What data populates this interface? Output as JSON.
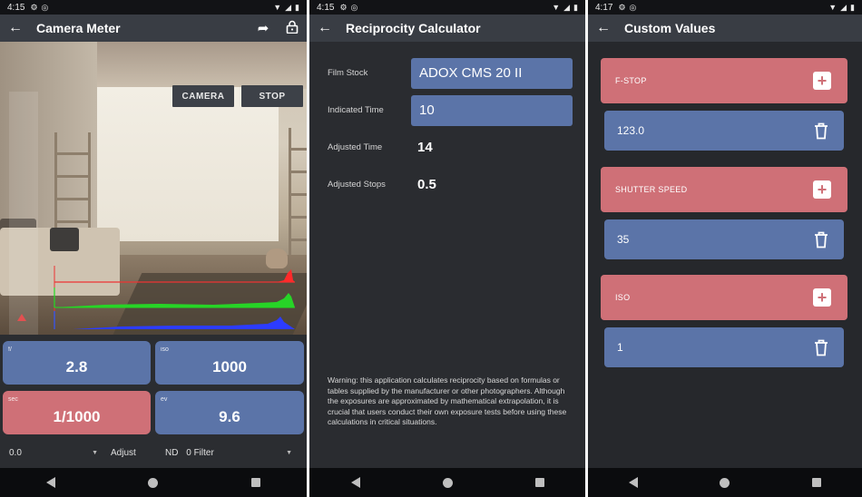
{
  "screen1": {
    "status": {
      "time": "4:15"
    },
    "appbar": {
      "title": "Camera Meter"
    },
    "buttons": {
      "camera": "CAMERA",
      "stop": "STOP"
    },
    "tiles": {
      "fstop": {
        "label": "f/",
        "value": "2.8"
      },
      "iso": {
        "label": "iso",
        "value": "1000"
      },
      "sec": {
        "label": "sec",
        "value": "1/1000"
      },
      "ev": {
        "label": "ev",
        "value": "9.6"
      }
    },
    "bottom": {
      "adjust_value": "0.0",
      "adjust_label": "Adjust",
      "nd_label": "ND",
      "nd_value": "0 Filter"
    },
    "histogram_colors": [
      "#ff2a2a",
      "#27d427",
      "#2c3cff"
    ]
  },
  "screen2": {
    "status": {
      "time": "4:15"
    },
    "appbar": {
      "title": "Reciprocity Calculator"
    },
    "film_stock": {
      "label": "Film Stock",
      "value": "ADOX CMS 20 II"
    },
    "indicated_time": {
      "label": "Indicated Time",
      "value": "10"
    },
    "adjusted_time": {
      "label": "Adjusted Time",
      "value": "14"
    },
    "adjusted_stops": {
      "label": "Adjusted Stops",
      "value": "0.5"
    },
    "warning": "Warning: this application calculates reciprocity based on formulas or tables supplied by the manufacturer or other photographers. Although the exposures are approximated by mathematical extrapolation, it is crucial that users conduct their own exposure tests before using these calculations in critical situations."
  },
  "screen3": {
    "status": {
      "time": "4:17"
    },
    "appbar": {
      "title": "Custom Values"
    },
    "groups": [
      {
        "header": "F-STOP",
        "value": "123.0"
      },
      {
        "header": "SHUTTER SPEED",
        "value": "35"
      },
      {
        "header": "ISO",
        "value": "1"
      }
    ]
  },
  "colors": {
    "tile_blue": "#5b74a8",
    "tile_red": "#cf7077",
    "appbar": "#393d44",
    "background": "#2b2d31"
  }
}
